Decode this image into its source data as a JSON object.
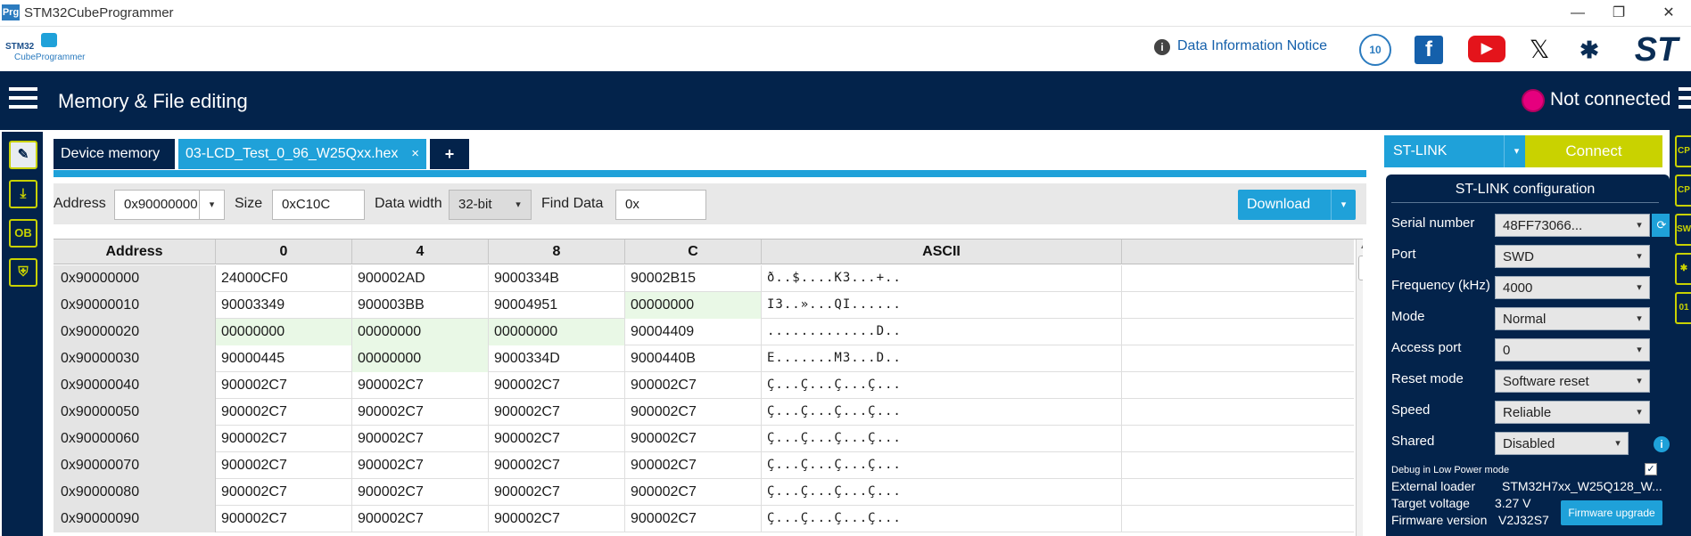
{
  "window": {
    "app_icon": "Prg",
    "title": "STM32CubeProgrammer",
    "controls": {
      "minimize": "—",
      "maximize": "❐",
      "close": "✕"
    }
  },
  "brand": {
    "logo_line1": "STM32",
    "logo_line2": "CubeProgrammer",
    "info_icon": "i",
    "data_notice": "Data Information Notice",
    "anniversary_badge": "10",
    "social": {
      "facebook": "f",
      "youtube": "▶",
      "x": "𝕏",
      "network": "✱",
      "st": "ST"
    }
  },
  "nav": {
    "title": "Memory & File editing",
    "connection_status": "Not connected",
    "status_color": "#e6007e"
  },
  "left_rail": {
    "items": [
      {
        "icon": "pencil-icon",
        "glyph": "✎",
        "active": true
      },
      {
        "icon": "download-icon",
        "glyph": "⤓",
        "active": false
      },
      {
        "icon": "ob-icon",
        "glyph": "OB",
        "active": false
      },
      {
        "icon": "shield-icon",
        "glyph": "⛨",
        "active": false
      }
    ]
  },
  "tabs": {
    "device_memory": "Device memory",
    "file": "03-LCD_Test_0_96_W25Qxx.hex",
    "close": "×",
    "add": "+"
  },
  "toolbar": {
    "address_label": "Address",
    "address_value": "0x90000000",
    "size_label": "Size",
    "size_value": "0xC10C",
    "data_width_label": "Data width",
    "data_width_value": "32-bit",
    "find_label": "Find Data",
    "find_value": "0x",
    "download_label": "Download",
    "caret": "▾"
  },
  "memory_grid": {
    "columns": [
      "Address",
      "0",
      "4",
      "8",
      "C",
      "ASCII"
    ],
    "rows": [
      {
        "addr": "0x90000000",
        "c0": "24000CF0",
        "c4": "900002AD",
        "c8": "9000334B",
        "cc": "90002B15",
        "ascii": "ð..$....K3...+.."
      },
      {
        "addr": "0x90000010",
        "c0": "90003349",
        "c4": "900003BB",
        "c8": "90004951",
        "cc": "00000000",
        "ascii": "I3..»...QI......"
      },
      {
        "addr": "0x90000020",
        "c0": "00000000",
        "c4": "00000000",
        "c8": "00000000",
        "cc": "90004409",
        "ascii": ".............D.."
      },
      {
        "addr": "0x90000030",
        "c0": "90000445",
        "c4": "00000000",
        "c8": "9000334D",
        "cc": "9000440B",
        "ascii": "E.......M3...D.."
      },
      {
        "addr": "0x90000040",
        "c0": "900002C7",
        "c4": "900002C7",
        "c8": "900002C7",
        "cc": "900002C7",
        "ascii": "Ç...Ç...Ç...Ç..."
      },
      {
        "addr": "0x90000050",
        "c0": "900002C7",
        "c4": "900002C7",
        "c8": "900002C7",
        "cc": "900002C7",
        "ascii": "Ç...Ç...Ç...Ç..."
      },
      {
        "addr": "0x90000060",
        "c0": "900002C7",
        "c4": "900002C7",
        "c8": "900002C7",
        "cc": "900002C7",
        "ascii": "Ç...Ç...Ç...Ç..."
      },
      {
        "addr": "0x90000070",
        "c0": "900002C7",
        "c4": "900002C7",
        "c8": "900002C7",
        "cc": "900002C7",
        "ascii": "Ç...Ç...Ç...Ç..."
      },
      {
        "addr": "0x90000080",
        "c0": "900002C7",
        "c4": "900002C7",
        "c8": "900002C7",
        "cc": "900002C7",
        "ascii": "Ç...Ç...Ç...Ç..."
      },
      {
        "addr": "0x90000090",
        "c0": "900002C7",
        "c4": "900002C7",
        "c8": "900002C7",
        "cc": "900002C7",
        "ascii": "Ç...Ç...Ç...Ç..."
      }
    ],
    "scroll_up": "▲"
  },
  "connection": {
    "interface": "ST-LINK",
    "connect_label": "Connect",
    "caret": "▾"
  },
  "stlink_config": {
    "title": "ST-LINK configuration",
    "serial_label": "Serial number",
    "serial_value": "48FF73066...",
    "refresh_icon": "⟳",
    "port_label": "Port",
    "port_value": "SWD",
    "freq_label": "Frequency (kHz)",
    "freq_value": "4000",
    "mode_label": "Mode",
    "mode_value": "Normal",
    "access_port_label": "Access port",
    "access_port_value": "0",
    "reset_label": "Reset mode",
    "reset_value": "Software reset",
    "speed_label": "Speed",
    "speed_value": "Reliable",
    "shared_label": "Shared",
    "shared_value": "Disabled",
    "info_icon": "i",
    "debug_lp_label": "Debug in Low Power mode",
    "debug_lp_check": "✓",
    "ext_loader_label": "External loader",
    "ext_loader_value": "STM32H7xx_W25Q128_W...",
    "target_voltage_label": "Target voltage",
    "target_voltage_value": "3.27 V",
    "fw_version_label": "Firmware version",
    "fw_version_value": "V2J32S7",
    "fw_upgrade_label": "Firmware upgrade"
  },
  "right_rail": {
    "items": [
      "CP",
      "CP",
      "SW",
      "✱",
      "01"
    ]
  }
}
